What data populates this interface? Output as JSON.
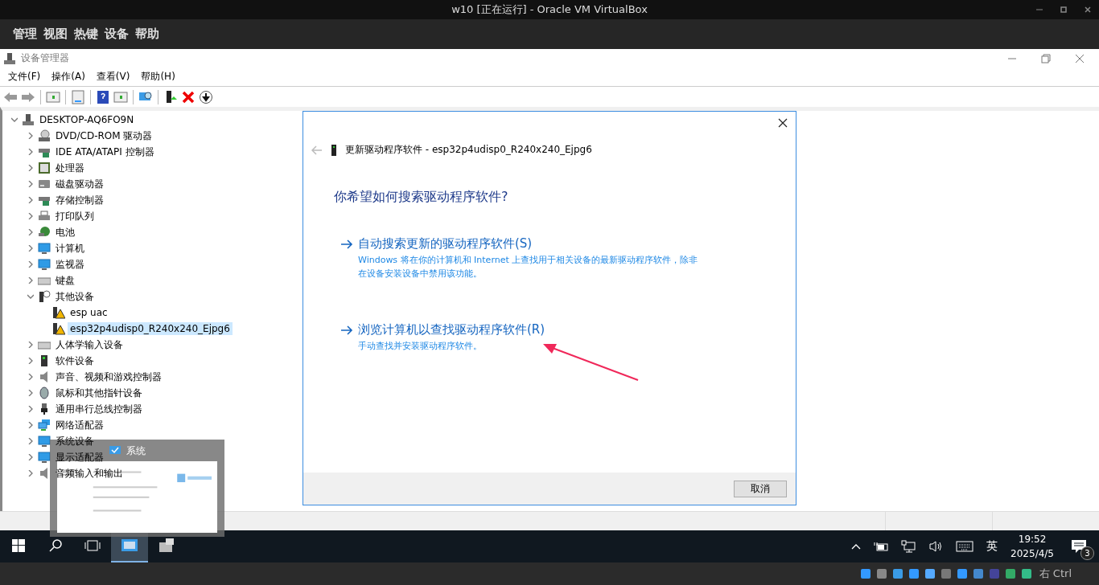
{
  "vm_window": {
    "title": "w10 [正在运行] - Oracle VM VirtualBox"
  },
  "vm_menu": [
    "管理",
    "视图",
    "热键",
    "设备",
    "帮助"
  ],
  "device_manager": {
    "title": "设备管理器",
    "menu": [
      "文件(F)",
      "操作(A)",
      "查看(V)",
      "帮助(H)"
    ],
    "tree": {
      "label": "DESKTOP-AQ6FO9N",
      "kind": "computer",
      "expanded": true,
      "children": [
        {
          "label": "DVD/CD-ROM 驱动器",
          "kind": "disc",
          "expanded": false
        },
        {
          "label": "IDE ATA/ATAPI 控制器",
          "kind": "controller",
          "expanded": false
        },
        {
          "label": "处理器",
          "kind": "chip",
          "expanded": false
        },
        {
          "label": "磁盘驱动器",
          "kind": "drive",
          "expanded": false
        },
        {
          "label": "存储控制器",
          "kind": "controller",
          "expanded": false
        },
        {
          "label": "打印队列",
          "kind": "printer",
          "expanded": false
        },
        {
          "label": "电池",
          "kind": "battery",
          "expanded": false
        },
        {
          "label": "计算机",
          "kind": "monitor",
          "expanded": false
        },
        {
          "label": "监视器",
          "kind": "monitor",
          "expanded": false
        },
        {
          "label": "键盘",
          "kind": "keyboard",
          "expanded": false
        },
        {
          "label": "其他设备",
          "kind": "unknown",
          "expanded": true,
          "children": [
            {
              "label": "esp uac",
              "kind": "warning",
              "selected": false
            },
            {
              "label": "esp32p4udisp0_R240x240_Ejpg6",
              "kind": "warning",
              "selected": true
            }
          ]
        },
        {
          "label": "人体学输入设备",
          "kind": "keyboard",
          "expanded": false
        },
        {
          "label": "软件设备",
          "kind": "tower",
          "expanded": false
        },
        {
          "label": "声音、视频和游戏控制器",
          "kind": "speaker",
          "expanded": false
        },
        {
          "label": "鼠标和其他指针设备",
          "kind": "mouse",
          "expanded": false
        },
        {
          "label": "通用串行总线控制器",
          "kind": "usb",
          "expanded": false
        },
        {
          "label": "网络适配器",
          "kind": "network",
          "expanded": false
        },
        {
          "label": "系统设备",
          "kind": "monitor",
          "expanded": false
        },
        {
          "label": "显示适配器",
          "kind": "monitor",
          "expanded": false
        },
        {
          "label": "音频输入和输出",
          "kind": "speaker",
          "expanded": false
        }
      ]
    }
  },
  "dialog": {
    "title": "更新驱动程序软件 - esp32p4udisp0_R240x240_Ejpg6",
    "heading": "你希望如何搜索驱动程序软件?",
    "options": [
      {
        "label": "自动搜索更新的驱动程序软件(S)",
        "description": "Windows 将在你的计算机和 Internet 上查找用于相关设备的最新驱动程序软件，除非在设备安装设备中禁用该功能。"
      },
      {
        "label": "浏览计算机以查找驱动程序软件(R)",
        "description": "手动查找并安装驱动程序软件。"
      }
    ],
    "cancel": "取消"
  },
  "taskbar": {
    "apps": [
      {
        "kind": "devmgr",
        "selected": true
      },
      {
        "kind": "vbox",
        "selected": false
      }
    ],
    "input_method": "英",
    "time": "19:52",
    "date": "2025/4/5",
    "notifications": "3"
  },
  "taskbar_preview": {
    "title": "系统"
  },
  "vm_status": {
    "host_key": "右 Ctrl"
  }
}
